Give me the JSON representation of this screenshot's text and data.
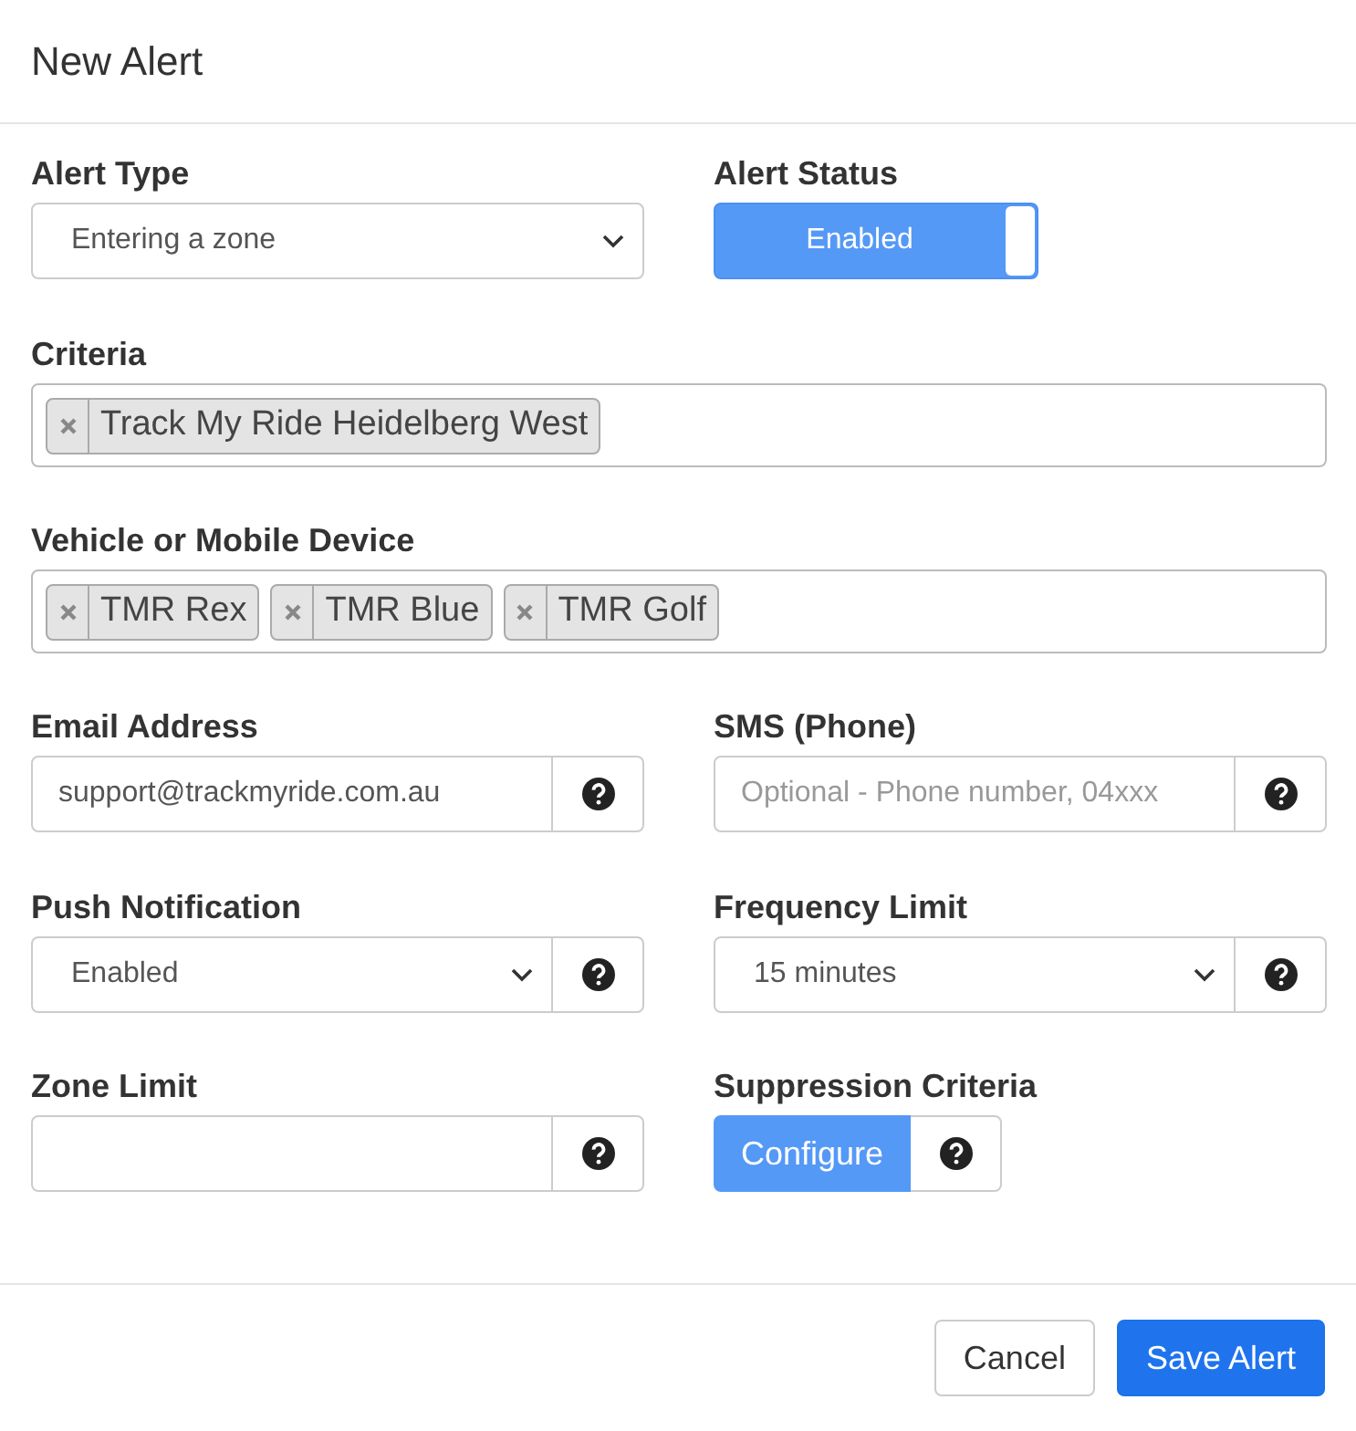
{
  "title": "New Alert",
  "rows": [
    {
      "fields": [
        {
          "kind": "select",
          "label": "Alert Type",
          "value": "Entering a zone"
        },
        {
          "kind": "toggle",
          "label": "Alert Status",
          "text": "Enabled",
          "on": true
        }
      ]
    },
    {
      "fields": [
        {
          "kind": "tags",
          "label": "Criteria",
          "tags": [
            "Track My Ride Heidelberg West"
          ]
        }
      ]
    },
    {
      "fields": [
        {
          "kind": "tags",
          "label": "Vehicle or Mobile Device",
          "tags": [
            "TMR Rex",
            "TMR Blue",
            "TMR Golf"
          ]
        }
      ]
    },
    {
      "fields": [
        {
          "kind": "input",
          "label": "Email Address",
          "value": "support@trackmyride.com.au"
        },
        {
          "kind": "input",
          "label": "SMS (Phone)",
          "placeholder": "Optional - Phone number, 04xxx"
        }
      ]
    },
    {
      "fields": [
        {
          "kind": "select",
          "label": "Push Notification",
          "value": "Enabled",
          "help": true
        },
        {
          "kind": "select",
          "label": "Frequency Limit",
          "value": "15 minutes",
          "help": true
        }
      ]
    },
    {
      "fields": [
        {
          "kind": "input",
          "label": "Zone Limit"
        },
        {
          "kind": "button",
          "label": "Suppression Criteria",
          "text": "Configure"
        }
      ]
    }
  ],
  "buttons": [
    {
      "text": "Cancel",
      "primary": false
    },
    {
      "text": "Save Alert",
      "primary": true
    }
  ]
}
